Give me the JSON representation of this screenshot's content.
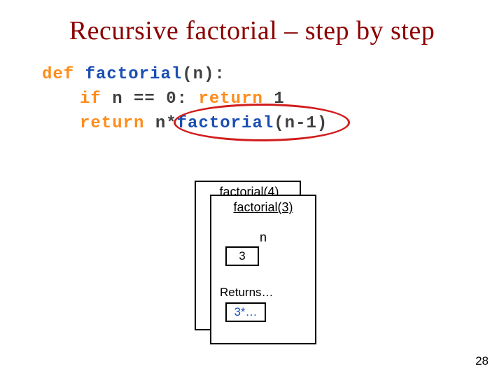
{
  "title": "Recursive factorial – step by step",
  "code": {
    "def": "def",
    "fname": "factorial",
    "lparen": "(",
    "param": "n",
    "rparen_colon": "):",
    "if_kw": "if",
    "cond_lhs": "n",
    "cond_op": "==",
    "cond_rhs": "0",
    "colon": ":",
    "return1": "return",
    "ret1_val": "1",
    "return2": "return",
    "ret2_lhs": "n",
    "ret2_op": "*",
    "ret2_call": "factorial",
    "ret2_arg_l": "(",
    "ret2_arg": "n-1",
    "ret2_arg_r": ")"
  },
  "stack": {
    "frame_back_title": "factorial(4)",
    "frame_front_title": "factorial(3)",
    "n_label": "n",
    "n_value": "3",
    "returns_label": "Returns…",
    "returns_value": "3*…"
  },
  "page_number": "28"
}
